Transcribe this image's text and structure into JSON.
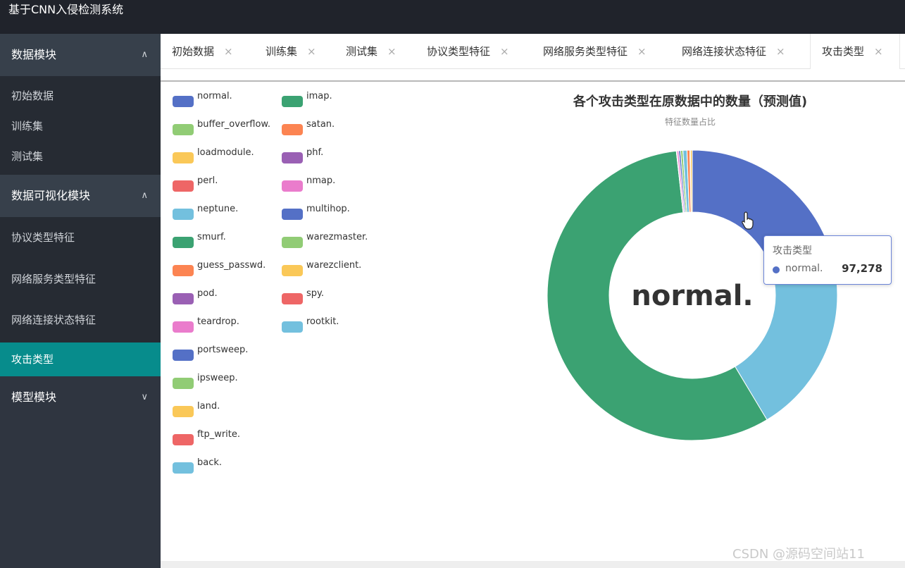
{
  "app": {
    "title": "基于CNN入侵检测系统"
  },
  "sidebar": {
    "groups": [
      {
        "label": "数据模块",
        "expanded": true,
        "items": [
          "初始数据",
          "训练集",
          "测试集"
        ]
      },
      {
        "label": "数据可视化模块",
        "expanded": true,
        "items": [
          "协议类型特征",
          "网络服务类型特征",
          "网络连接状态特征",
          "攻击类型"
        ]
      },
      {
        "label": "模型模块",
        "expanded": false,
        "items": []
      }
    ],
    "active_item": "攻击类型"
  },
  "tabs": [
    {
      "label": "初始数据"
    },
    {
      "label": "训练集"
    },
    {
      "label": "测试集"
    },
    {
      "label": "协议类型特征"
    },
    {
      "label": "网络服务类型特征"
    },
    {
      "label": "网络连接状态特征"
    },
    {
      "label": "攻击类型",
      "active": true
    }
  ],
  "tab_close_glyph": "×",
  "chart_data": {
    "type": "pie",
    "title": "各个攻击类型在原数据中的数量（预测值)",
    "subtitle": "特征数量占比",
    "center_label": "normal.",
    "legend_placement": "left",
    "palette": [
      "#5470c6",
      "#91cc75",
      "#fac858",
      "#ee6666",
      "#73c0de",
      "#3ba272",
      "#fc8452",
      "#9a60b4",
      "#ea7ccc"
    ],
    "legend": [
      "normal.",
      "buffer_overflow.",
      "loadmodule.",
      "perl.",
      "neptune.",
      "smurf.",
      "guess_passwd.",
      "pod.",
      "teardrop.",
      "portsweep.",
      "ipsweep.",
      "land.",
      "ftp_write.",
      "back.",
      "imap.",
      "satan.",
      "phf.",
      "nmap.",
      "multihop.",
      "warezmaster.",
      "warezclient.",
      "spy.",
      "rootkit."
    ],
    "slices": [
      {
        "name": "normal.",
        "value": 97278
      },
      {
        "name": "buffer_overflow.",
        "value": 30
      },
      {
        "name": "loadmodule.",
        "value": 9
      },
      {
        "name": "perl.",
        "value": 3
      },
      {
        "name": "neptune.",
        "value": 107201
      },
      {
        "name": "smurf.",
        "value": 280790
      },
      {
        "name": "guess_passwd.",
        "value": 53
      },
      {
        "name": "pod.",
        "value": 264
      },
      {
        "name": "teardrop.",
        "value": 979
      },
      {
        "name": "portsweep.",
        "value": 1040
      },
      {
        "name": "ipsweep.",
        "value": 1247
      },
      {
        "name": "land.",
        "value": 21
      },
      {
        "name": "ftp_write.",
        "value": 8
      },
      {
        "name": "back.",
        "value": 2203
      },
      {
        "name": "imap.",
        "value": 12
      },
      {
        "name": "satan.",
        "value": 1589
      },
      {
        "name": "phf.",
        "value": 4
      },
      {
        "name": "nmap.",
        "value": 231
      },
      {
        "name": "multihop.",
        "value": 7
      },
      {
        "name": "warezmaster.",
        "value": 20
      },
      {
        "name": "warezclient.",
        "value": 1020
      },
      {
        "name": "spy.",
        "value": 2
      },
      {
        "name": "rootkit.",
        "value": 10
      }
    ]
  },
  "tooltip": {
    "title": "攻击类型",
    "name": "normal.",
    "value": "97,278"
  },
  "watermark": "CSDN @源码空间站11"
}
